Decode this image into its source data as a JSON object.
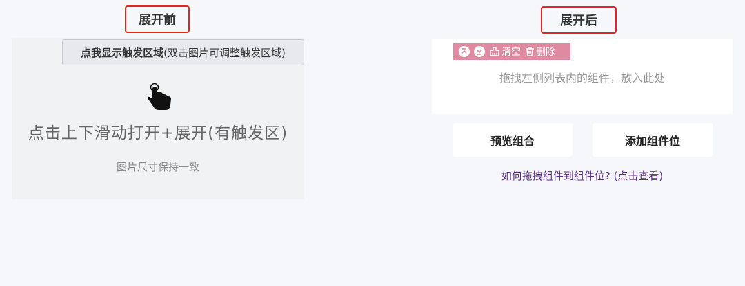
{
  "labels": {
    "before": "展开前",
    "after": "展开后"
  },
  "left": {
    "trigger_bold": "点我显示触发区域",
    "trigger_rest": "(双击图片可调整触发区域)",
    "main_text": "点击上下滑动打开+展开(有触发区)",
    "sub_text": "图片尺寸保持一致"
  },
  "right": {
    "toolbar": {
      "clear": "清空",
      "delete": "删除"
    },
    "drop_hint": "拖拽左侧列表内的组件，放入此处",
    "preview_button": "预览组合",
    "add_button": "添加组件位",
    "help_link": "如何拖拽组件到组件位? (点击查看)"
  },
  "icons": {
    "hand": "pointing-hand-icon",
    "collapse": "collapse-up-icon",
    "expand": "expand-down-icon",
    "clear": "broom-icon",
    "delete": "trash-icon"
  },
  "colors": {
    "highlight_border": "#e5241b",
    "toolbar_bg": "#e08aa1",
    "link": "#5b2c83"
  }
}
